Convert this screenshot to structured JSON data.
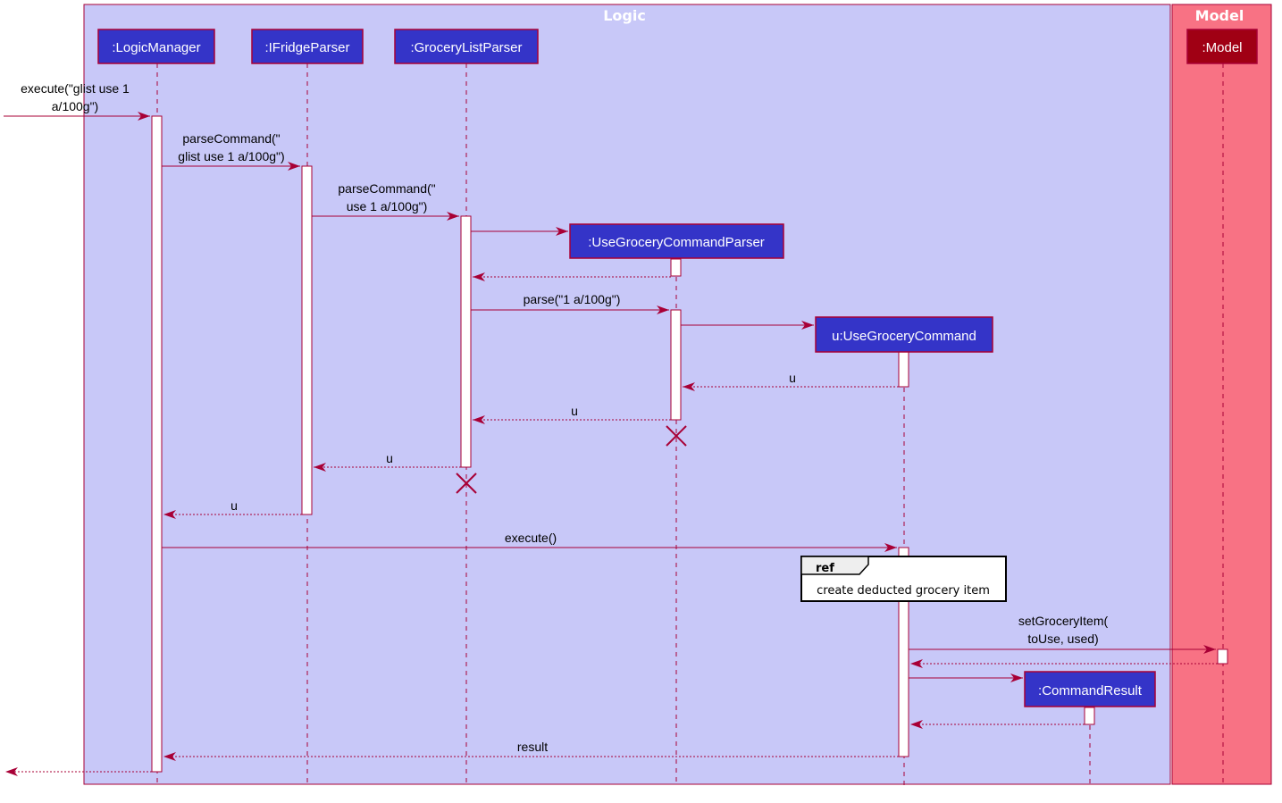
{
  "colors": {
    "logic_box_fill": "#c8c8f8",
    "model_box_fill": "#f87284",
    "border": "#a80036",
    "participant_fill": "#3434c8",
    "model_participant_fill": "#a00014",
    "activation_fill": "#ffffff",
    "ref_fill": "#ffffff",
    "ref_header_fill": "#eeeeee"
  },
  "boxes": [
    {
      "id": "logic",
      "title": "Logic"
    },
    {
      "id": "model",
      "title": "Model"
    }
  ],
  "participants": [
    {
      "id": "lm",
      "label": ":LogicManager"
    },
    {
      "id": "ifp",
      "label": ":IFridgeParser"
    },
    {
      "id": "glp",
      "label": ":GroceryListParser"
    },
    {
      "id": "ugcp",
      "label": ":UseGroceryCommandParser"
    },
    {
      "id": "ugc",
      "label": "u:UseGroceryCommand"
    },
    {
      "id": "cr",
      "label": ":CommandResult"
    },
    {
      "id": "model",
      "label": ":Model"
    }
  ],
  "messages": [
    {
      "from": "external",
      "to": "lm",
      "type": "sync",
      "lines": [
        "execute(\"glist use 1",
        "a/100g\")"
      ]
    },
    {
      "from": "lm",
      "to": "ifp",
      "type": "sync",
      "lines": [
        "parseCommand(\"",
        "glist use 1 a/100g\")"
      ]
    },
    {
      "from": "ifp",
      "to": "glp",
      "type": "sync",
      "lines": [
        "parseCommand(\"",
        "use 1 a/100g\")"
      ]
    },
    {
      "from": "glp",
      "to": "ugcp",
      "type": "create",
      "lines": []
    },
    {
      "from": "ugcp",
      "to": "glp",
      "type": "return",
      "lines": []
    },
    {
      "from": "glp",
      "to": "ugcp",
      "type": "sync",
      "lines": [
        "parse(\"1 a/100g\")"
      ]
    },
    {
      "from": "ugcp",
      "to": "ugc",
      "type": "create",
      "lines": []
    },
    {
      "from": "ugc",
      "to": "ugcp",
      "type": "return",
      "lines": [
        "u"
      ]
    },
    {
      "from": "ugcp",
      "to": "glp",
      "type": "return",
      "lines": [
        "u"
      ]
    },
    {
      "from": "glp",
      "to": "ifp",
      "type": "return",
      "lines": [
        "u"
      ]
    },
    {
      "from": "ifp",
      "to": "lm",
      "type": "return",
      "lines": [
        "u"
      ]
    },
    {
      "from": "lm",
      "to": "ugc",
      "type": "sync",
      "lines": [
        "execute()"
      ]
    },
    {
      "from": "ugc",
      "to": "model",
      "type": "sync",
      "lines": [
        "setGroceryItem(",
        "toUse, used)"
      ]
    },
    {
      "from": "model",
      "to": "ugc",
      "type": "return",
      "lines": []
    },
    {
      "from": "ugc",
      "to": "cr",
      "type": "create",
      "lines": []
    },
    {
      "from": "cr",
      "to": "ugc",
      "type": "return",
      "lines": []
    },
    {
      "from": "ugc",
      "to": "lm",
      "type": "return",
      "lines": [
        "result"
      ]
    },
    {
      "from": "lm",
      "to": "external",
      "type": "return",
      "lines": []
    }
  ],
  "destroyed": [
    "ugcp",
    "glp"
  ],
  "ref": {
    "tag": "ref",
    "text": "create deducted grocery item"
  }
}
